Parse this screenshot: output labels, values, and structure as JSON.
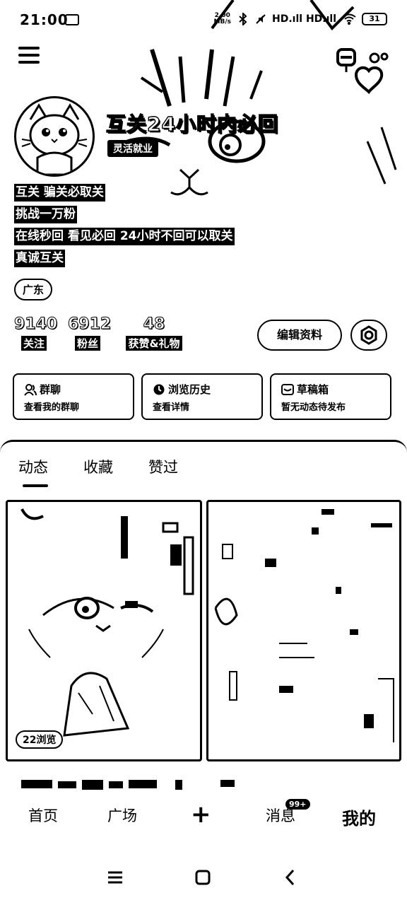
{
  "status_bar": {
    "time": "21:00",
    "net_speed_value": "2.00",
    "net_speed_unit": "MB/s",
    "signal_text": "HD.ıll HD.ıll",
    "battery": "31"
  },
  "profile": {
    "nickname": "互关24小时内必回",
    "tag": "灵活就业",
    "bio": [
      "互关 骗关必取关",
      "挑战一万粉",
      "在线秒回 看见必回 24小时不回可以取关",
      "真诚互关"
    ],
    "location": "广东"
  },
  "stats": [
    {
      "value": "9140",
      "label": "关注"
    },
    {
      "value": "6912",
      "label": "粉丝"
    },
    {
      "value": "48",
      "label": "获赞&礼物"
    }
  ],
  "actions": {
    "edit_label": "编辑资料"
  },
  "cards": [
    {
      "title": "群聊",
      "subtitle": "查看我的群聊",
      "icon": "group-icon"
    },
    {
      "title": "浏览历史",
      "subtitle": "查看详情",
      "icon": "clock-icon"
    },
    {
      "title": "草稿箱",
      "subtitle": "暂无动态待发布",
      "icon": "draft-icon"
    }
  ],
  "tabs": [
    "动态",
    "收藏",
    "赞过"
  ],
  "posts": {
    "views_badge": "22浏览"
  },
  "bottom_nav": {
    "home": "首页",
    "square": "广场",
    "plus": "+",
    "messages": "消息",
    "messages_badge": "99+",
    "me": "我的"
  }
}
